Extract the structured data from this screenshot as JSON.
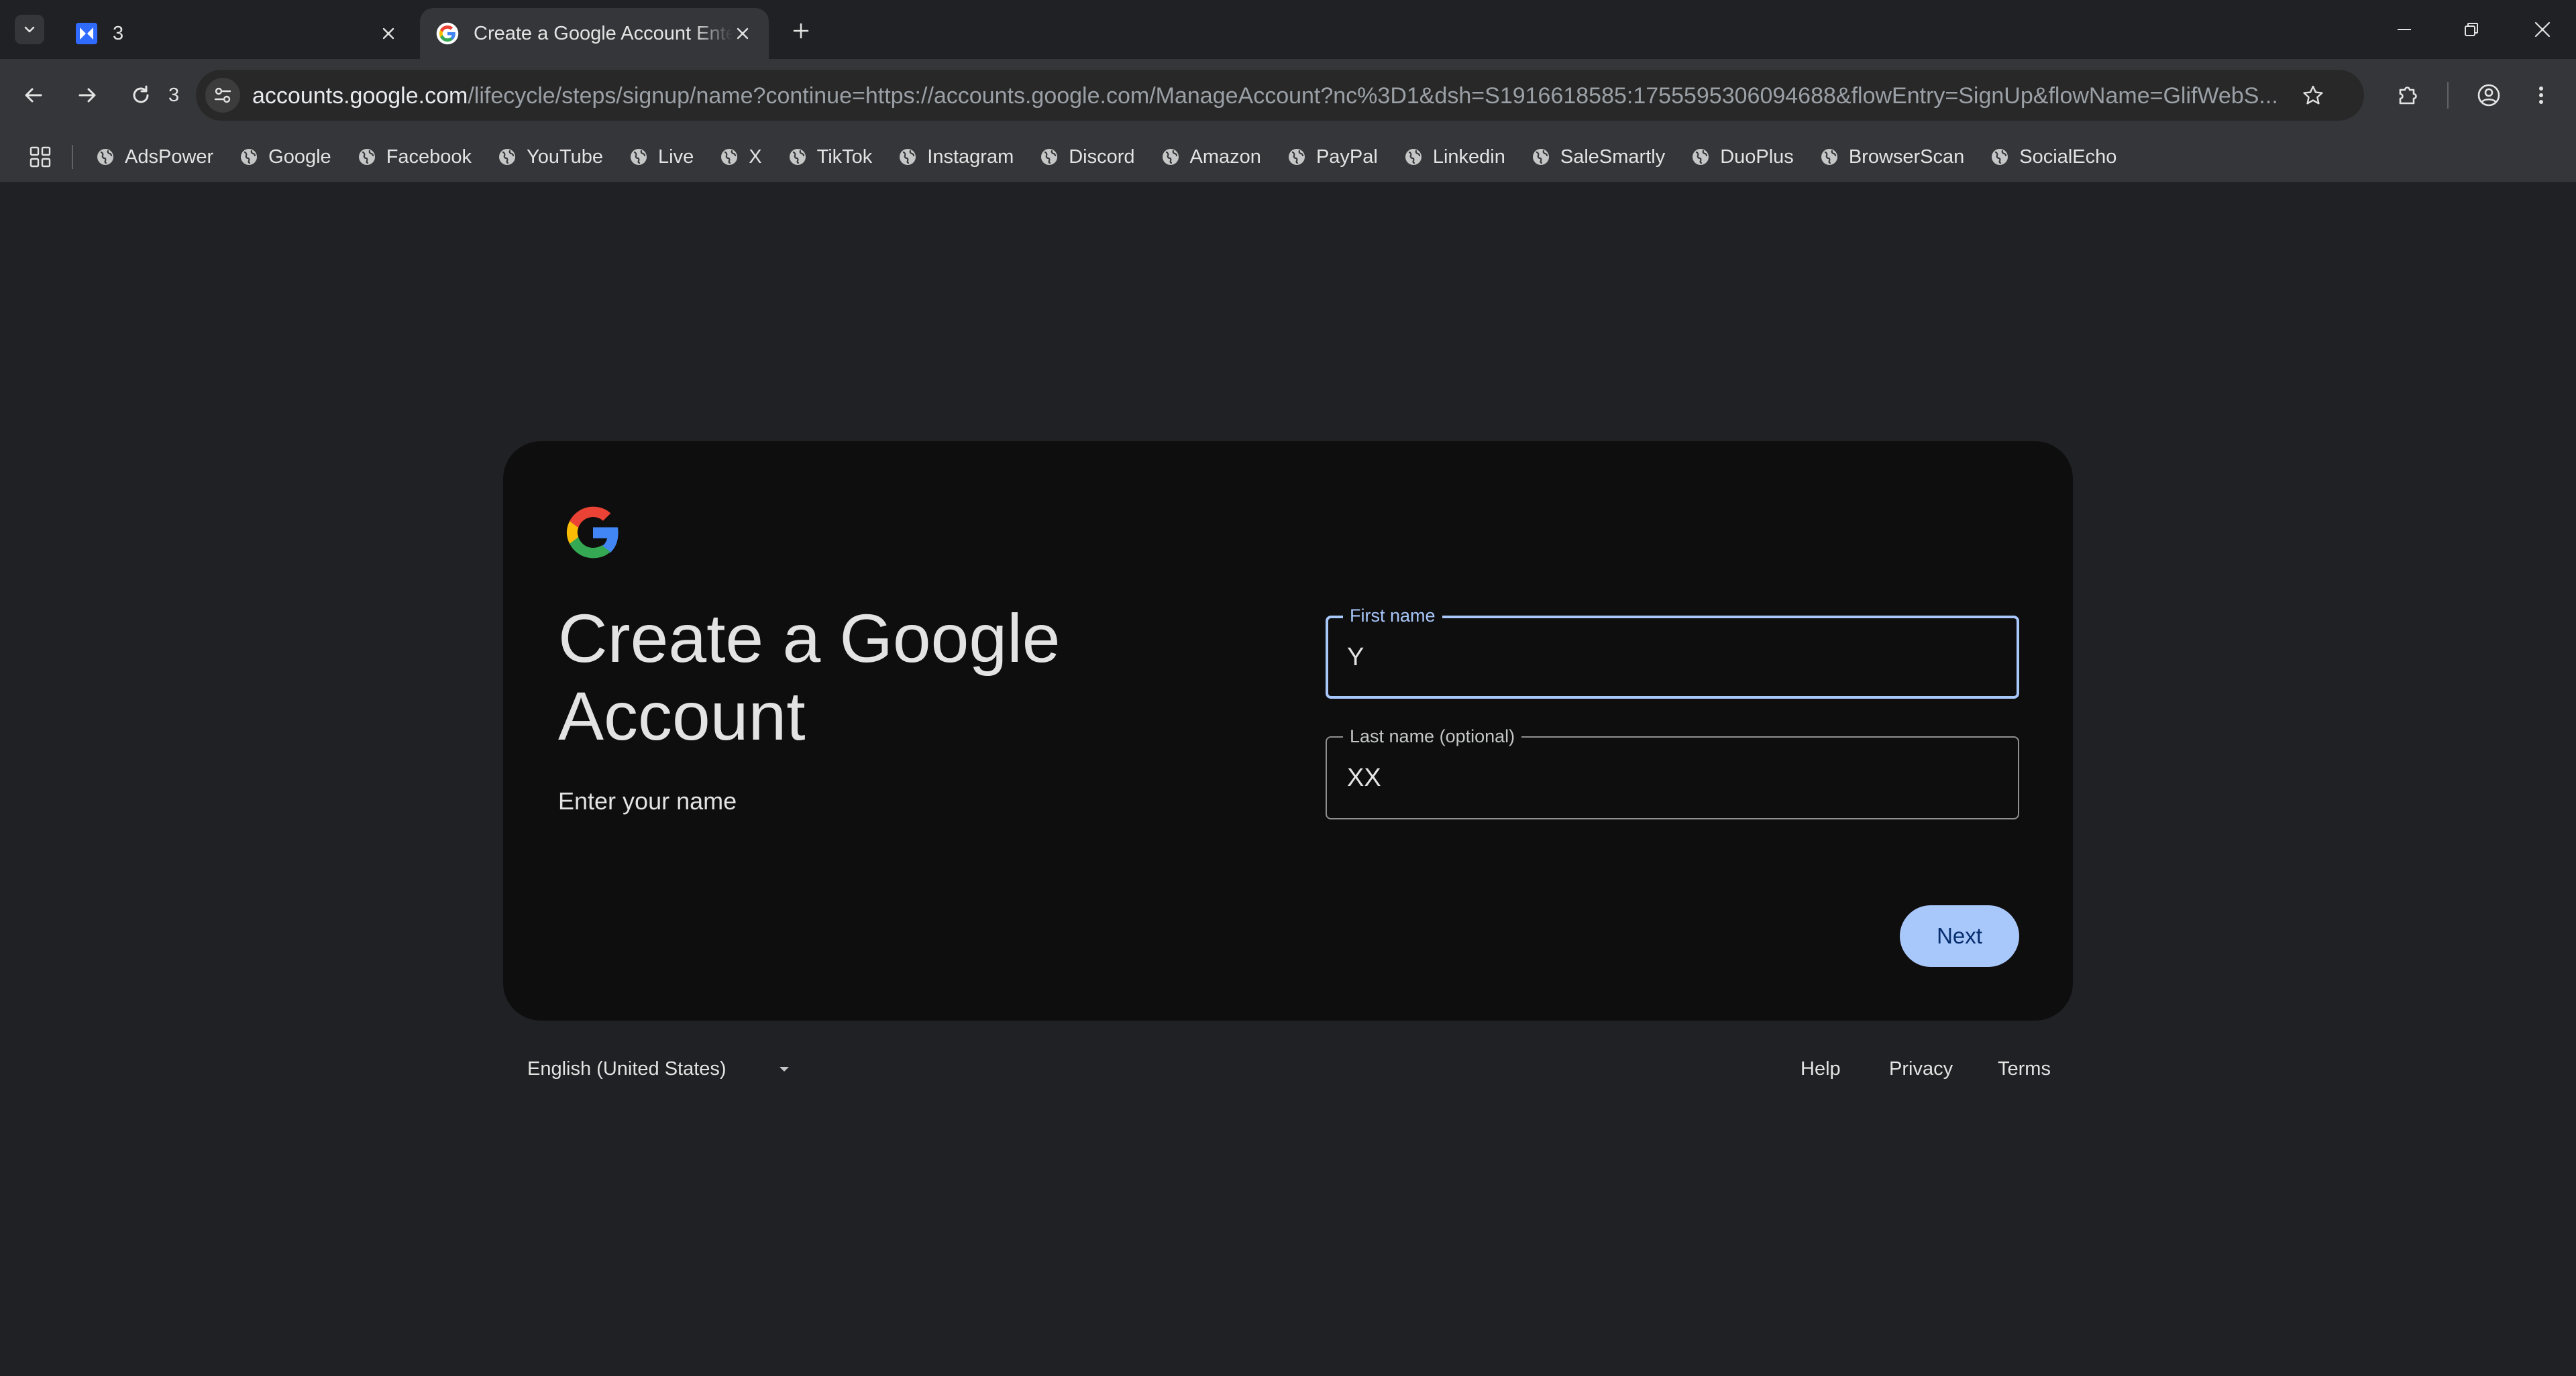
{
  "browser": {
    "tabs": [
      {
        "title": "3",
        "active": false
      },
      {
        "title": "Create a Google Account Enter your name",
        "active": true
      }
    ],
    "reload_badge": "3",
    "url_host": "accounts.google.com",
    "url_path": "/lifecycle/steps/signup/name?continue=https://accounts.google.com/ManageAccount?nc%3D1&dsh=S1916618585:1755595306094688&flowEntry=SignUp&flowName=GlifWebS...",
    "bookmarks": [
      "AdsPower",
      "Google",
      "Facebook",
      "YouTube",
      "Live",
      "X",
      "TikTok",
      "Instagram",
      "Discord",
      "Amazon",
      "PayPal",
      "Linkedin",
      "SaleSmartly",
      "DuoPlus",
      "BrowserScan",
      "SocialEcho"
    ]
  },
  "signup": {
    "heading": "Create a Google Account",
    "subheading": "Enter your name",
    "first_name_label": "First name",
    "first_name_value": "Y",
    "last_name_label": "Last name (optional)",
    "last_name_value": "XX",
    "next_label": "Next"
  },
  "footer": {
    "language": "English (United States)",
    "help": "Help",
    "privacy": "Privacy",
    "terms": "Terms"
  },
  "colors": {
    "page_bg": "#202124",
    "card_bg": "#0e0e0e",
    "accent": "#a8c7fa",
    "button_text": "#062e6f"
  }
}
